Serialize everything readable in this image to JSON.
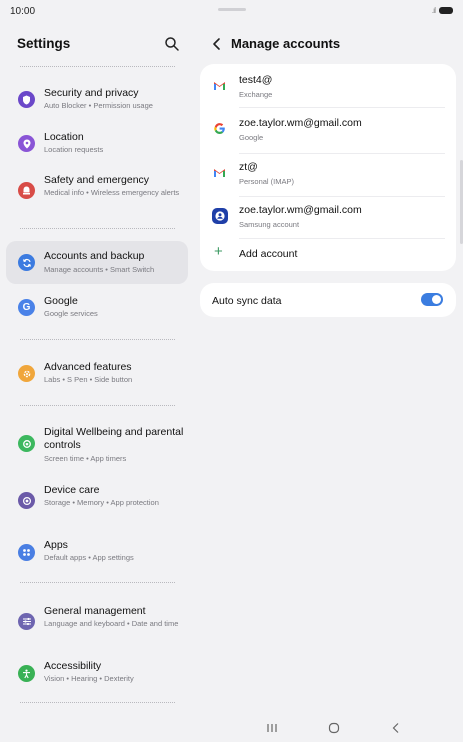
{
  "status": {
    "time": "10:00",
    "signal": ".ıl"
  },
  "settings": {
    "title": "Settings",
    "items": [
      {
        "title": "Security and privacy",
        "subtitle": "Auto Blocker • Permission usage",
        "icon": "shield-icon",
        "color": "#6b48c9"
      },
      {
        "title": "Location",
        "subtitle": "Location requests",
        "icon": "location-pin-icon",
        "color": "#8a55d6"
      },
      {
        "title": "Safety and emergency",
        "subtitle": "Medical info • Wireless emergency alerts",
        "icon": "alert-icon",
        "color": "#d84c47"
      },
      {
        "title": "Accounts and backup",
        "subtitle": "Manage accounts • Smart Switch",
        "icon": "sync-icon",
        "color": "#3c7be0"
      },
      {
        "title": "Google",
        "subtitle": "Google services",
        "icon": "google-icon",
        "color": "#4a82e8"
      },
      {
        "title": "Advanced features",
        "subtitle": "Labs • S Pen • Side button",
        "icon": "gear-icon",
        "color": "#f0a63b"
      },
      {
        "title": "Digital Wellbeing and parental controls",
        "subtitle": "Screen time • App timers",
        "icon": "wellbeing-icon",
        "color": "#3db85f"
      },
      {
        "title": "Device care",
        "subtitle": "Storage • Memory • App protection",
        "icon": "device-care-icon",
        "color": "#6b5aa8"
      },
      {
        "title": "Apps",
        "subtitle": "Default apps • App settings",
        "icon": "apps-grid-icon",
        "color": "#4a7fe3"
      },
      {
        "title": "General management",
        "subtitle": "Language and keyboard • Date and time",
        "icon": "sliders-icon",
        "color": "#6e65b0"
      },
      {
        "title": "Accessibility",
        "subtitle": "Vision • Hearing • Dexterity",
        "icon": "accessibility-icon",
        "color": "#39b155"
      }
    ]
  },
  "manage": {
    "title": "Manage accounts",
    "accounts": [
      {
        "name": "test4@",
        "type": "Exchange",
        "icon": "gmail-icon"
      },
      {
        "name": "zoe.taylor.wm@gmail.com",
        "type": "Google",
        "icon": "google-icon"
      },
      {
        "name": "zt@",
        "type": "Personal (IMAP)",
        "icon": "gmail-icon"
      },
      {
        "name": "zoe.taylor.wm@gmail.com",
        "type": "Samsung account",
        "icon": "samsung-account-icon"
      }
    ],
    "add_label": "Add account",
    "sync_label": "Auto sync data",
    "sync_on": true,
    "accent": "#3b7de0"
  }
}
